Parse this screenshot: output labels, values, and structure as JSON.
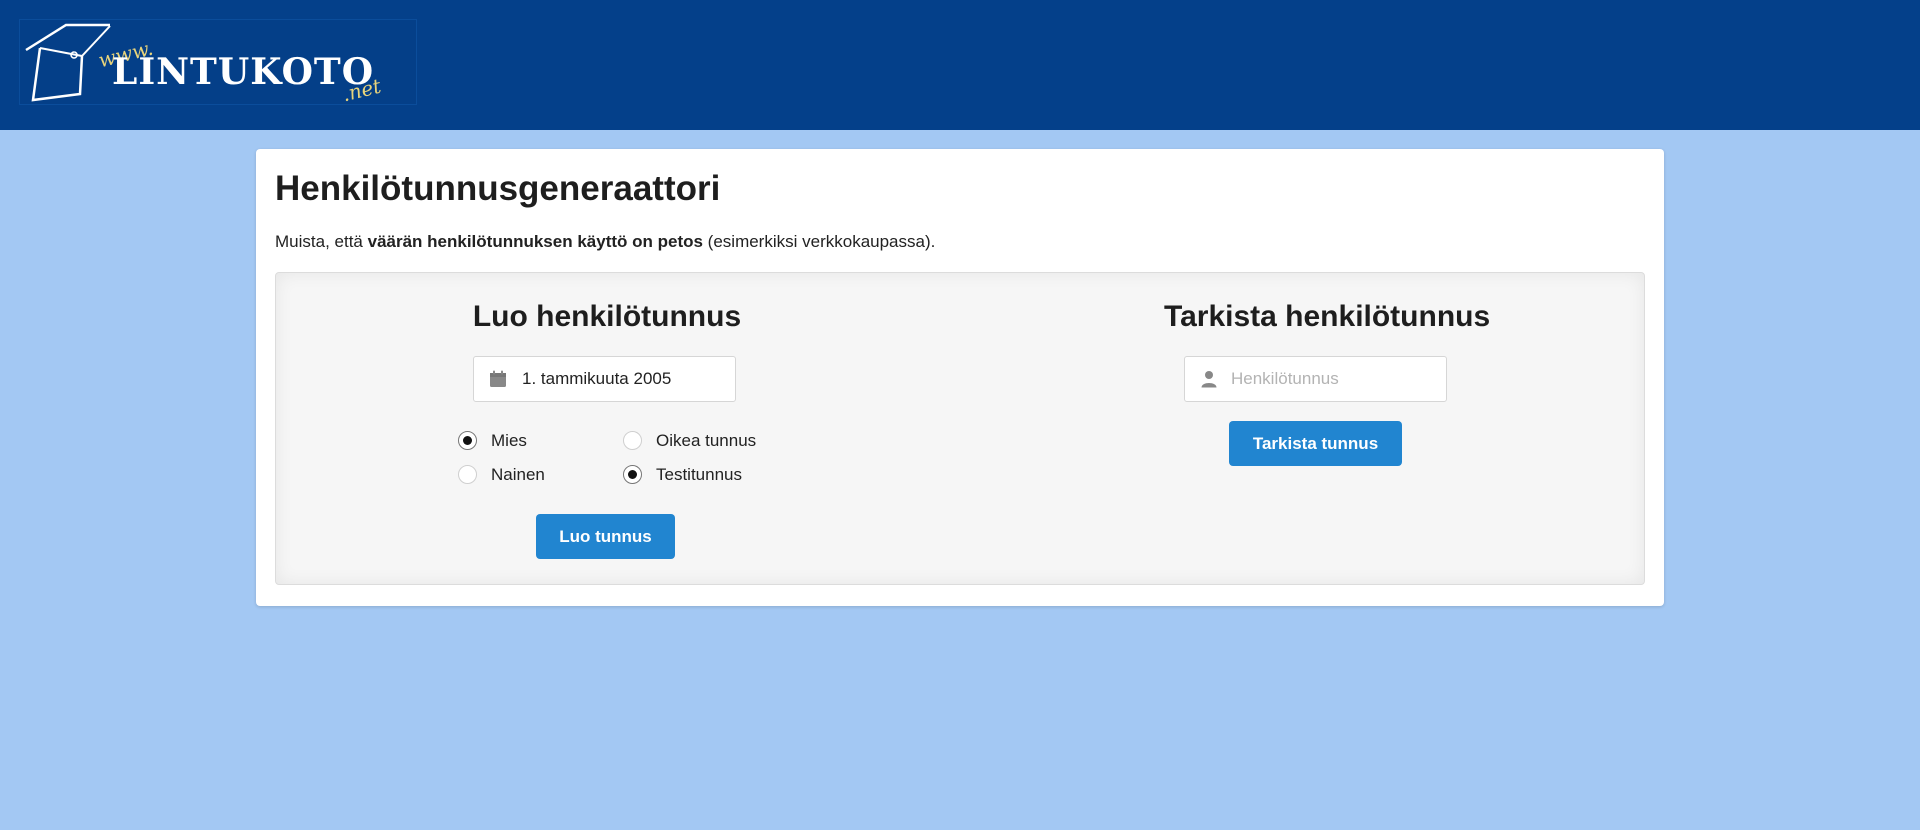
{
  "header": {
    "logo": {
      "prefix": "www.",
      "name": "LINTUKOTO",
      "suffix": ".net"
    }
  },
  "page": {
    "title": "Henkilötunnusgeneraattori",
    "notice": {
      "before": "Muista, että ",
      "bold": "väärän henkilötunnuksen käyttö on petos",
      "after": " (esimerkiksi verkkokaupassa)."
    }
  },
  "generator": {
    "title": "Luo henkilötunnus",
    "date_icon": "calendar-icon",
    "date_value": "1. tammikuuta 2005",
    "gender_options": [
      {
        "label": "Mies",
        "checked": true
      },
      {
        "label": "Nainen",
        "checked": false
      }
    ],
    "type_options": [
      {
        "label": "Oikea tunnus",
        "checked": false
      },
      {
        "label": "Testitunnus",
        "checked": true
      }
    ],
    "button_label": "Luo tunnus"
  },
  "checker": {
    "title": "Tarkista henkilötunnus",
    "input_icon": "user-icon",
    "input_placeholder": "Henkilötunnus",
    "input_value": "",
    "button_label": "Tarkista tunnus"
  },
  "colors": {
    "header_bg": "#04408a",
    "page_bg": "#a3c8f3",
    "button_bg": "#2185d0",
    "logo_accent": "#e8d47b"
  }
}
